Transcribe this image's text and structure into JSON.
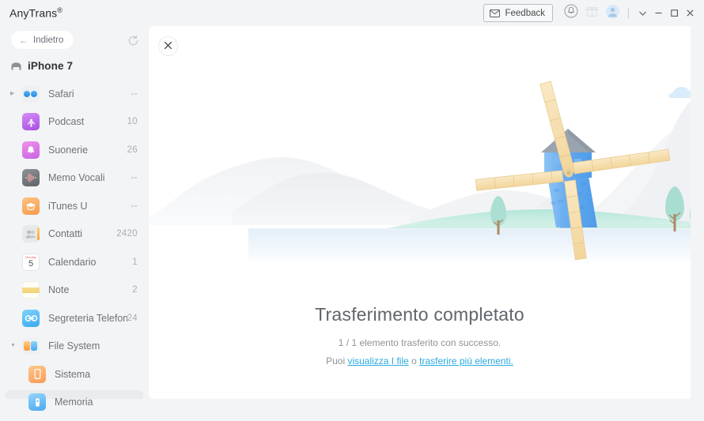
{
  "window": {
    "brand": "AnyTrans",
    "brand_reg": "®",
    "feedback_label": "Feedback",
    "feedback_icon": "envelope-icon",
    "bell_icon": "bell-icon",
    "gift_icon": "gift-icon",
    "account_icon": "account-avatar-icon",
    "chevron_icon": "chevron-down-icon",
    "minimize_icon": "minimize-icon",
    "maximize_icon": "maximize-icon",
    "close_icon": "close-icon"
  },
  "sidebar": {
    "back_label": "Indietro",
    "back_icon": "arrow-left-icon",
    "refresh_icon": "refresh-icon",
    "device_name": "iPhone 7",
    "device_icon": "device-icon",
    "items": [
      {
        "label": "Safari",
        "count": "--",
        "icon": "safari-icon",
        "expandable": true,
        "expanded": false,
        "selected": false,
        "child": false
      },
      {
        "label": "Podcast",
        "count": "10",
        "icon": "podcast-icon",
        "expandable": false,
        "expanded": false,
        "selected": false,
        "child": false
      },
      {
        "label": "Suonerie",
        "count": "26",
        "icon": "ringtones-icon",
        "expandable": false,
        "expanded": false,
        "selected": false,
        "child": false
      },
      {
        "label": "Memo Vocali",
        "count": "--",
        "icon": "voice-memo-icon",
        "expandable": false,
        "expanded": false,
        "selected": false,
        "child": false
      },
      {
        "label": "iTunes U",
        "count": "--",
        "icon": "itunes-u-icon",
        "expandable": false,
        "expanded": false,
        "selected": false,
        "child": false
      },
      {
        "label": "Contatti",
        "count": "2420",
        "icon": "contacts-icon",
        "expandable": false,
        "expanded": false,
        "selected": false,
        "child": false
      },
      {
        "label": "Calendario",
        "count": "1",
        "icon": "calendar-icon",
        "expandable": false,
        "expanded": false,
        "selected": false,
        "child": false
      },
      {
        "label": "Note",
        "count": "2",
        "icon": "notes-icon",
        "expandable": false,
        "expanded": false,
        "selected": false,
        "child": false
      },
      {
        "label": "Segreteria Telefonica",
        "count": "24",
        "icon": "voicemail-icon",
        "expandable": false,
        "expanded": false,
        "selected": false,
        "child": false
      },
      {
        "label": "File System",
        "count": "",
        "icon": "file-system-icon",
        "expandable": true,
        "expanded": true,
        "selected": false,
        "child": false
      },
      {
        "label": "Sistema",
        "count": "",
        "icon": "system-icon",
        "expandable": false,
        "expanded": false,
        "selected": false,
        "child": true
      },
      {
        "label": "Memoria",
        "count": "",
        "icon": "storage-icon",
        "expandable": false,
        "expanded": false,
        "selected": true,
        "child": true
      }
    ],
    "calendar_icon_text": {
      "month": "Monday",
      "day": "5"
    }
  },
  "panel": {
    "close_icon": "close-icon",
    "illustration": "windmill-landscape-illustration",
    "headline": "Trasferimento completato",
    "subline": "1 / 1 elemento trasferito con successo.",
    "third_prefix": "Puoi ",
    "link_view": "visualizza I file",
    "third_middle": " o ",
    "link_more": "trasferire più elementi.",
    "third_suffix": ""
  },
  "colors": {
    "app_background": "#f2f4f6",
    "panel_background": "#ffffff",
    "link": "#2aaae1",
    "headline_text": "#5f666d",
    "body_text": "#8d9398",
    "sidebar_text": "#6d7379",
    "selected_row": "#e9ebee",
    "windmill_tower": "#5aa7f0",
    "windmill_blade": "#f5dca6",
    "windmill_roof": "#9aa3ad",
    "grass": "#a9e3d4",
    "cloud": "#d6ecfb",
    "tree_foliage": "#a8ddd1",
    "tree_trunk": "#b08a62"
  }
}
